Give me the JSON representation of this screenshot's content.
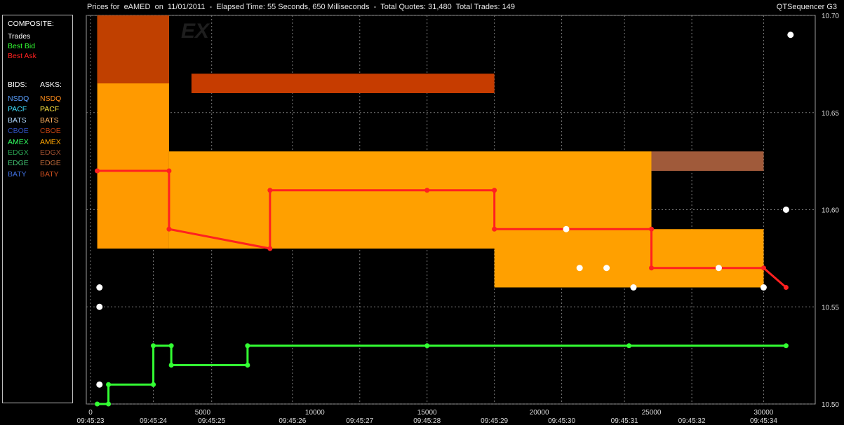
{
  "header": {
    "title": "Prices for  eAMED  on  11/01/2011  -  Elapsed Time: 55 Seconds, 650 Milliseconds  -  Total Quotes: 31,480  Total Trades: 149",
    "app_name": "QTSequencer G3"
  },
  "legend": {
    "composite_heading": "COMPOSITE:",
    "composite": [
      {
        "label": "Trades",
        "color": "#ffffff"
      },
      {
        "label": "Best Bid",
        "color": "#33ff33"
      },
      {
        "label": "Best Ask",
        "color": "#ff2020"
      }
    ],
    "bids_heading": "BIDS:",
    "asks_heading": "ASKS:",
    "venues": [
      {
        "bid": "NSDQ",
        "ask": "NSDQ",
        "bid_color": "#5aa0ff",
        "ask_color": "#ff8c1a"
      },
      {
        "bid": "PACF",
        "ask": "PACF",
        "bid_color": "#40e0ff",
        "ask_color": "#ffe640"
      },
      {
        "bid": "BATS",
        "ask": "BATS",
        "bid_color": "#b0d8ff",
        "ask_color": "#ffb060"
      },
      {
        "bid": "CBOE",
        "ask": "CBOE",
        "bid_color": "#3050c0",
        "ask_color": "#c04010"
      },
      {
        "bid": "AMEX",
        "ask": "AMEX",
        "bid_color": "#30ff60",
        "ask_color": "#ffa500"
      },
      {
        "bid": "EDGX",
        "ask": "EDGX",
        "bid_color": "#2aa050",
        "ask_color": "#a05030"
      },
      {
        "bid": "EDGE",
        "ask": "EDGE",
        "bid_color": "#40c070",
        "ask_color": "#c06a3a"
      },
      {
        "bid": "BATY",
        "ask": "BATY",
        "bid_color": "#4070e0",
        "ask_color": "#d05020"
      }
    ]
  },
  "watermark": "EX",
  "chart_data": {
    "type": "line",
    "xlim": [
      0,
      31300
    ],
    "ylim": [
      10.5,
      10.7
    ],
    "y_ticks": [
      "10.50",
      "10.55",
      "10.60",
      "10.65",
      "10.70"
    ],
    "x_ticks": [
      {
        "x": 0,
        "label": "0"
      },
      {
        "x": 5000,
        "label": "5000"
      },
      {
        "x": 10000,
        "label": "10000"
      },
      {
        "x": 15000,
        "label": "15000"
      },
      {
        "x": 20000,
        "label": "20000"
      },
      {
        "x": 25000,
        "label": "25000"
      },
      {
        "x": 30000,
        "label": "30000"
      }
    ],
    "time_labels": [
      {
        "x": 0,
        "label": "09:45:23"
      },
      {
        "x": 2800,
        "label": "09:45:24"
      },
      {
        "x": 5400,
        "label": "09:45:25"
      },
      {
        "x": 9000,
        "label": "09:45:26"
      },
      {
        "x": 12000,
        "label": "09:45:27"
      },
      {
        "x": 15000,
        "label": "09:45:28"
      },
      {
        "x": 18000,
        "label": "09:45:29"
      },
      {
        "x": 21000,
        "label": "09:45:30"
      },
      {
        "x": 23800,
        "label": "09:45:31"
      },
      {
        "x": 26800,
        "label": "09:45:32"
      },
      {
        "x": 30000,
        "label": "09:45:34"
      }
    ],
    "grid": true,
    "series": [
      {
        "name": "Best Ask",
        "color": "#ff2020",
        "x": [
          300,
          3500,
          3500,
          8000,
          8000,
          15000,
          18000,
          18000,
          25000,
          25000,
          30000,
          31000
        ],
        "y": [
          10.62,
          10.62,
          10.59,
          10.58,
          10.61,
          10.61,
          10.61,
          10.59,
          10.59,
          10.57,
          10.57,
          10.56
        ]
      },
      {
        "name": "Best Bid",
        "color": "#33ff33",
        "x": [
          300,
          800,
          800,
          2800,
          2800,
          3600,
          3600,
          7000,
          7000,
          15000,
          24000,
          31000
        ],
        "y": [
          10.5,
          10.5,
          10.51,
          10.51,
          10.53,
          10.53,
          10.52,
          10.52,
          10.53,
          10.53,
          10.53,
          10.53
        ]
      },
      {
        "name": "Trades",
        "color": "#ffffff",
        "x": [
          400,
          400,
          400,
          21200,
          21800,
          23000,
          24200,
          28000,
          30000,
          31000,
          31200
        ],
        "y": [
          10.51,
          10.55,
          10.56,
          10.59,
          10.57,
          10.57,
          10.56,
          10.57,
          10.56,
          10.6,
          10.69
        ]
      }
    ]
  }
}
